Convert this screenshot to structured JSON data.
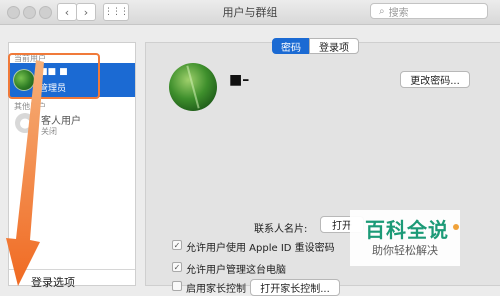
{
  "window": {
    "title": "用户与群组",
    "search_placeholder": "搜索"
  },
  "sidebar": {
    "current_users_label": "当前用户",
    "current_user": {
      "name": "■■ ■",
      "role": "管理员"
    },
    "other_users_label": "其他用户",
    "guest_user": {
      "name": "客人用户",
      "status": "关闭"
    },
    "login_options_label": "登录选项"
  },
  "main": {
    "tabs": [
      {
        "label": "密码",
        "selected": true
      },
      {
        "label": "登录项",
        "selected": false
      }
    ],
    "user_name": "■–",
    "change_password_label": "更改密码...",
    "contact_card_label": "联系人名片:",
    "contact_open_label": "打开",
    "checkboxes": [
      {
        "label": "允许用户使用 Apple ID 重设密码",
        "checked": true
      },
      {
        "label": "允许用户管理这台电脑",
        "checked": true
      },
      {
        "label": "启用家长控制",
        "checked": false
      }
    ],
    "parental_button_label": "打开家长控制..."
  },
  "watermark": {
    "title": "百科全说",
    "subtitle": "助你轻松解决"
  },
  "colors": {
    "selection_blue": "#1b6ad3",
    "highlight_orange": "#f07a3a",
    "watermark_green": "#1c9a77"
  }
}
